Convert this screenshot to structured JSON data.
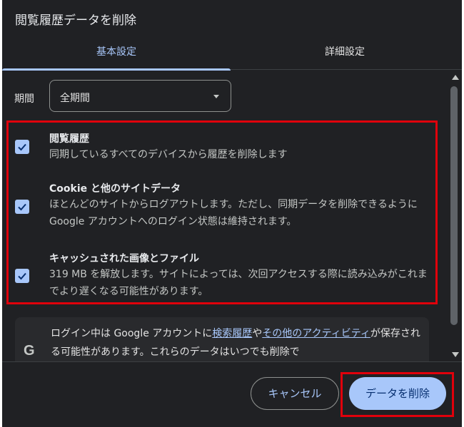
{
  "dialog": {
    "title": "閲覧履歴データを削除"
  },
  "tabs": [
    {
      "label": "基本設定",
      "active": true
    },
    {
      "label": "詳細設定",
      "active": false
    }
  ],
  "period": {
    "label": "期間",
    "value": "全期間"
  },
  "options": [
    {
      "title": "閲覧履歴",
      "description": "同期しているすべてのデバイスから履歴を削除します",
      "checked": true
    },
    {
      "title": "Cookie と他のサイトデータ",
      "description": "ほとんどのサイトからログアウトします。ただし、同期データを削除できるように Google アカウントへのログイン状態は維持されます。",
      "checked": true
    },
    {
      "title": "キャッシュされた画像とファイル",
      "description": "319 MB を解放します。サイトによっては、次回アクセスする際に読み込みがこれまでより遅くなる可能性があります。",
      "checked": true
    }
  ],
  "signin_notice": {
    "icon": "google-g-icon",
    "text_before": "ログイン中は Google アカウントに",
    "link1": "検索履歴",
    "text_mid": "や",
    "link2": "その他のアクティビティ",
    "text_after": "が保存される可能性があります。これらのデータはいつでも削除で"
  },
  "footer": {
    "cancel_label": "キャンセル",
    "delete_label": "データを削除"
  },
  "colors": {
    "background": "#202124",
    "accent": "#a8c7fa",
    "highlight": "#e0000b"
  }
}
